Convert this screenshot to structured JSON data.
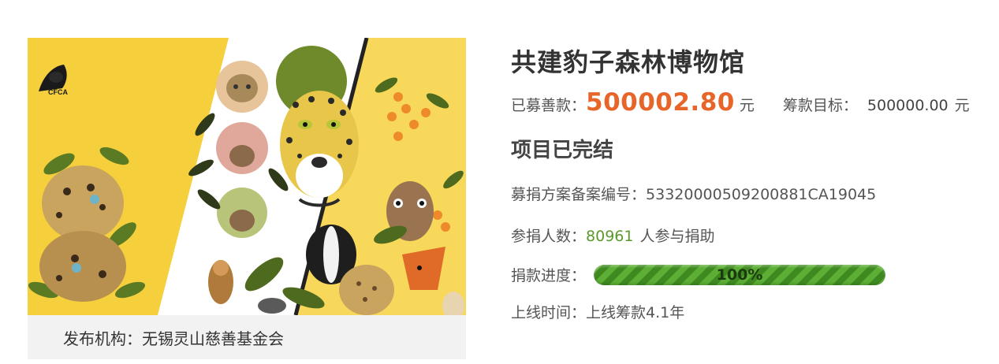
{
  "organization": {
    "label": "发布机构：",
    "name": "无锡灵山慈善基金会"
  },
  "banner": {
    "logo_text": "CFCA"
  },
  "project": {
    "title": "共建豹子森林博物馆",
    "raised_label": "已募善款：",
    "raised_amount": "500002.80",
    "raised_unit": "元",
    "goal_label": "筹款目标：",
    "goal_amount": "500000.00",
    "goal_unit": "元",
    "status": "项目已完结",
    "record_label": "募捐方案备案编号：",
    "record_number": "53320000509200881CA19045",
    "donors_label": "参捐人数：",
    "donors_count": "80961",
    "donors_suffix": "人参与捐助",
    "progress_label": "捐款进度：",
    "progress_text": "100%",
    "progress_fraction": 1.0,
    "online_label": "上线时间：",
    "online_value": "上线筹款4.1年"
  },
  "colors": {
    "accent_orange": "#e8652a",
    "donor_green": "#5a9a2a",
    "progress_green": "#4c9a2a",
    "banner_yellow": "#f6cf3c"
  }
}
